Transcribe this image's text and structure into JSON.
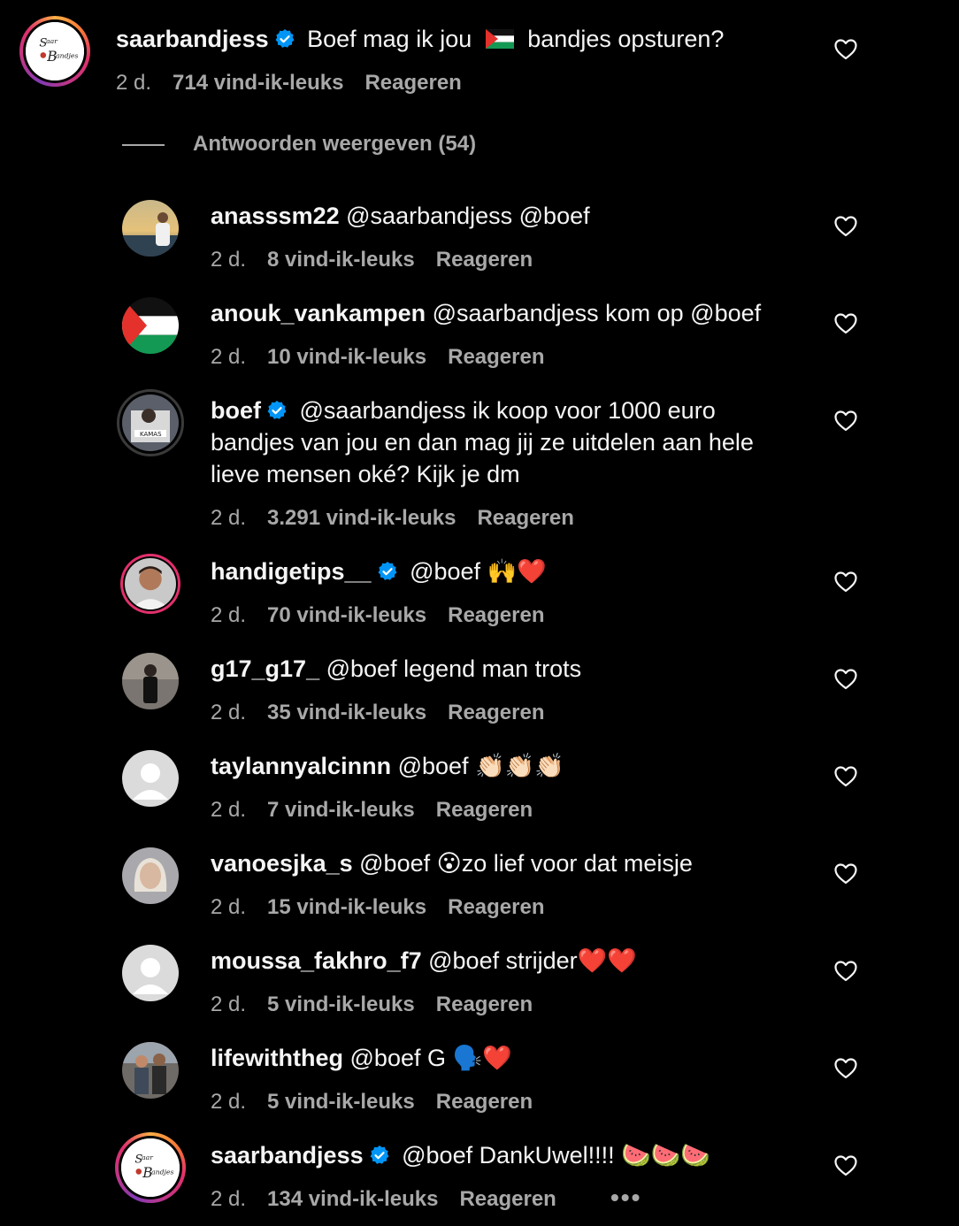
{
  "top_comment": {
    "username": "saarbandjess",
    "text_before": "Boef mag ik jou",
    "flag": "🇵🇸",
    "text_after": "bandjes opsturen?",
    "time": "2 d.",
    "likes": "714 vind-ik-leuks",
    "reply": "Reageren",
    "avatar_logo": "Saar Bandjes"
  },
  "view_replies": "Antwoorden weergeven (54)",
  "replies": [
    {
      "username": "anasssm22",
      "text": "@saarbandjess @boef",
      "time": "2 d.",
      "likes": "8 vind-ik-leuks",
      "reply": "Reageren"
    },
    {
      "username": "anouk_vankampen",
      "text": "@saarbandjess kom op @boef",
      "time": "2 d.",
      "likes": "10 vind-ik-leuks",
      "reply": "Reageren"
    },
    {
      "username": "boef",
      "line1": "@saarbandjess ik koop voor 1000 euro",
      "line2": "bandjes van jou en dan mag jij ze uitdelen aan hele",
      "line3": "lieve mensen oké? Kijk je dm",
      "time": "2 d.",
      "likes": "3.291 vind-ik-leuks",
      "reply": "Reageren"
    },
    {
      "username": "handigetips__",
      "text": "@boef",
      "emoji": "🙌❤️",
      "time": "2 d.",
      "likes": "70 vind-ik-leuks",
      "reply": "Reageren"
    },
    {
      "username": "g17_g17_",
      "text": "@boef legend man trots",
      "time": "2 d.",
      "likes": "35 vind-ik-leuks",
      "reply": "Reageren"
    },
    {
      "username": "taylannyalcinnn",
      "text": "@boef",
      "emoji": "👏🏻👏🏻👏🏻",
      "time": "2 d.",
      "likes": "7 vind-ik-leuks",
      "reply": "Reageren"
    },
    {
      "username": "vanoesjka_s",
      "text": "@boef",
      "emoji": "😮",
      "text_after": "zo lief voor dat meisje",
      "time": "2 d.",
      "likes": "15 vind-ik-leuks",
      "reply": "Reageren"
    },
    {
      "username": "moussa_fakhro_f7",
      "text": "@boef strijder",
      "emoji": "❤️❤️",
      "time": "2 d.",
      "likes": "5 vind-ik-leuks",
      "reply": "Reageren"
    },
    {
      "username": "lifewiththeg",
      "text": "@boef G",
      "emoji": "🗣️❤️",
      "time": "2 d.",
      "likes": "5 vind-ik-leuks",
      "reply": "Reageren"
    },
    {
      "username": "saarbandjess",
      "text": "@boef DankUwel!!!!",
      "emoji": "🍉🍉🍉",
      "time": "2 d.",
      "likes": "134 vind-ik-leuks",
      "reply": "Reageren",
      "more": "•••"
    }
  ],
  "colors": {
    "background": "#000000",
    "text": "#f5f5f5",
    "muted": "#a8a8a8",
    "verified": "#0095f6"
  }
}
